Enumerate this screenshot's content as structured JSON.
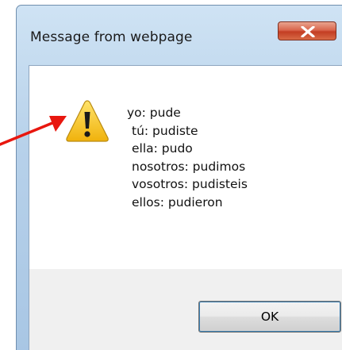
{
  "dialog": {
    "title": "Message from webpage",
    "icon": "warning-icon",
    "close_icon": "close-icon",
    "message_lines": [
      "yo: pude",
      "tú: pudiste",
      "ella: pudo",
      "nosotros: pudimos",
      "vosotros: pudisteis",
      "ellos: pudieron"
    ],
    "ok_label": "OK"
  },
  "annotation": {
    "arrow_color": "#e8170f"
  },
  "colors": {
    "warning_fill": "#f5c518",
    "close_button": "#c8452c"
  }
}
